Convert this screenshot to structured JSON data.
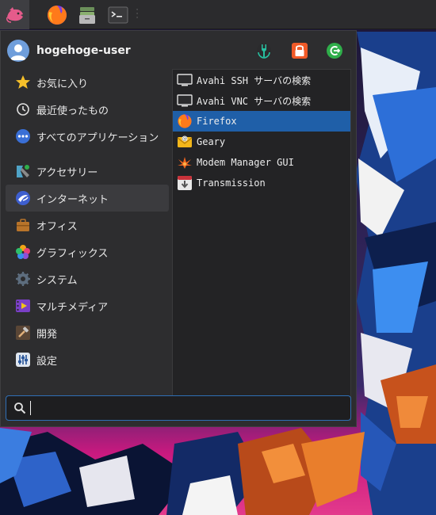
{
  "panel": {
    "launchers": [
      "whisker-menu",
      "firefox",
      "file-manager",
      "terminal"
    ]
  },
  "user": {
    "name": "hogehoge-user"
  },
  "actions": [
    "settings-manager",
    "lock-screen",
    "log-out"
  ],
  "categories": [
    {
      "label": "お気に入り",
      "icon": "star-icon"
    },
    {
      "label": "最近使ったもの",
      "icon": "clock-icon"
    },
    {
      "label": "すべてのアプリケーション",
      "icon": "all-apps-icon"
    },
    {
      "label": "アクセサリー",
      "icon": "accessories-icon"
    },
    {
      "label": "インターネット",
      "icon": "internet-icon",
      "active": true
    },
    {
      "label": "オフィス",
      "icon": "office-icon"
    },
    {
      "label": "グラフィックス",
      "icon": "graphics-icon"
    },
    {
      "label": "システム",
      "icon": "system-icon"
    },
    {
      "label": "マルチメディア",
      "icon": "multimedia-icon"
    },
    {
      "label": "開発",
      "icon": "development-icon"
    },
    {
      "label": "設定",
      "icon": "settings-icon"
    }
  ],
  "apps": [
    {
      "label": "Avahi SSH サーバの検索",
      "icon": "network-browser-icon"
    },
    {
      "label": "Avahi VNC サーバの検索",
      "icon": "network-browser-icon"
    },
    {
      "label": "Firefox",
      "icon": "firefox-icon",
      "selected": true
    },
    {
      "label": "Geary",
      "icon": "mail-icon"
    },
    {
      "label": "Modem Manager GUI",
      "icon": "modem-icon"
    },
    {
      "label": "Transmission",
      "icon": "transmission-icon"
    }
  ],
  "search": {
    "value": "",
    "placeholder": ""
  },
  "colors": {
    "selection": "#1f5fa8",
    "menu_bg": "#2d2d2f",
    "panel_bg": "#2b2b2d"
  }
}
